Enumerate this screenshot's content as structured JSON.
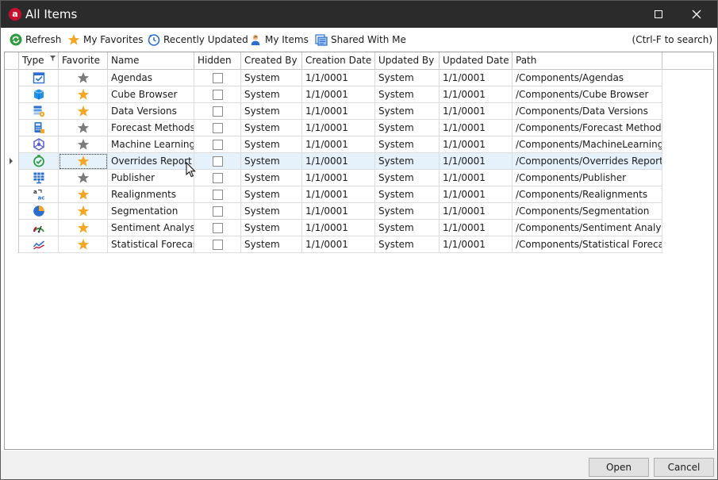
{
  "window": {
    "title": "All Items",
    "logo_letter": "a"
  },
  "toolbar": {
    "refresh": "Refresh",
    "my_favorites": "My Favorites",
    "recently_updated": "Recently Updated",
    "my_items": "My Items",
    "shared_with_me": "Shared With Me",
    "search_hint": "(Ctrl-F to search)"
  },
  "columns": {
    "type": "Type",
    "favorite": "Favorite",
    "name": "Name",
    "hidden": "Hidden",
    "created_by": "Created By",
    "creation_date": "Creation Date",
    "updated_by": "Updated By",
    "updated_date": "Updated Date",
    "path": "Path"
  },
  "rows": [
    {
      "icon": "agendas-icon",
      "favorite": false,
      "name": "Agendas",
      "hidden": false,
      "created_by": "System",
      "creation_date": "1/1/0001",
      "updated_by": "System",
      "updated_date": "1/1/0001",
      "path": "/Components/Agendas"
    },
    {
      "icon": "cube-icon",
      "favorite": true,
      "name": "Cube Browser",
      "hidden": false,
      "created_by": "System",
      "creation_date": "1/1/0001",
      "updated_by": "System",
      "updated_date": "1/1/0001",
      "path": "/Components/Cube Browser"
    },
    {
      "icon": "data-versions-icon",
      "favorite": true,
      "name": "Data Versions",
      "hidden": false,
      "created_by": "System",
      "creation_date": "1/1/0001",
      "updated_by": "System",
      "updated_date": "1/1/0001",
      "path": "/Components/Data Versions"
    },
    {
      "icon": "calculator-icon",
      "favorite": false,
      "name": "Forecast Methods",
      "hidden": false,
      "created_by": "System",
      "creation_date": "1/1/0001",
      "updated_by": "System",
      "updated_date": "1/1/0001",
      "path": "/Components/Forecast Methods"
    },
    {
      "icon": "machine-learning-icon",
      "favorite": false,
      "name": "Machine Learning",
      "hidden": false,
      "created_by": "System",
      "creation_date": "1/1/0001",
      "updated_by": "System",
      "updated_date": "1/1/0001",
      "path": "/Components/MachineLearning"
    },
    {
      "icon": "overrides-icon",
      "favorite": true,
      "name": "Overrides Report",
      "hidden": false,
      "created_by": "System",
      "creation_date": "1/1/0001",
      "updated_by": "System",
      "updated_date": "1/1/0001",
      "path": "/Components/Overrides Report",
      "selected": true
    },
    {
      "icon": "publisher-icon",
      "favorite": false,
      "name": "Publisher",
      "hidden": false,
      "created_by": "System",
      "creation_date": "1/1/0001",
      "updated_by": "System",
      "updated_date": "1/1/0001",
      "path": "/Components/Publisher"
    },
    {
      "icon": "realignments-icon",
      "favorite": true,
      "name": "Realignments",
      "hidden": false,
      "created_by": "System",
      "creation_date": "1/1/0001",
      "updated_by": "System",
      "updated_date": "1/1/0001",
      "path": "/Components/Realignments"
    },
    {
      "icon": "pie-chart-icon",
      "favorite": true,
      "name": "Segmentation",
      "hidden": false,
      "created_by": "System",
      "creation_date": "1/1/0001",
      "updated_by": "System",
      "updated_date": "1/1/0001",
      "path": "/Components/Segmentation"
    },
    {
      "icon": "gauge-icon",
      "favorite": true,
      "name": "Sentiment Analysis",
      "hidden": false,
      "created_by": "System",
      "creation_date": "1/1/0001",
      "updated_by": "System",
      "updated_date": "1/1/0001",
      "path": "/Components/Sentiment Analysis"
    },
    {
      "icon": "line-chart-icon",
      "favorite": true,
      "name": "Statistical Forecast",
      "hidden": false,
      "created_by": "System",
      "creation_date": "1/1/0001",
      "updated_by": "System",
      "updated_date": "1/1/0001",
      "path": "/Components/Statistical Forecast"
    }
  ],
  "footer": {
    "open": "Open",
    "cancel": "Cancel"
  },
  "colors": {
    "star_on": "#f5a623",
    "star_off": "#7a7a7a",
    "selected_row": "#e5f1fb",
    "titlebar": "#2b2b2b",
    "brand": "#c8102e"
  }
}
